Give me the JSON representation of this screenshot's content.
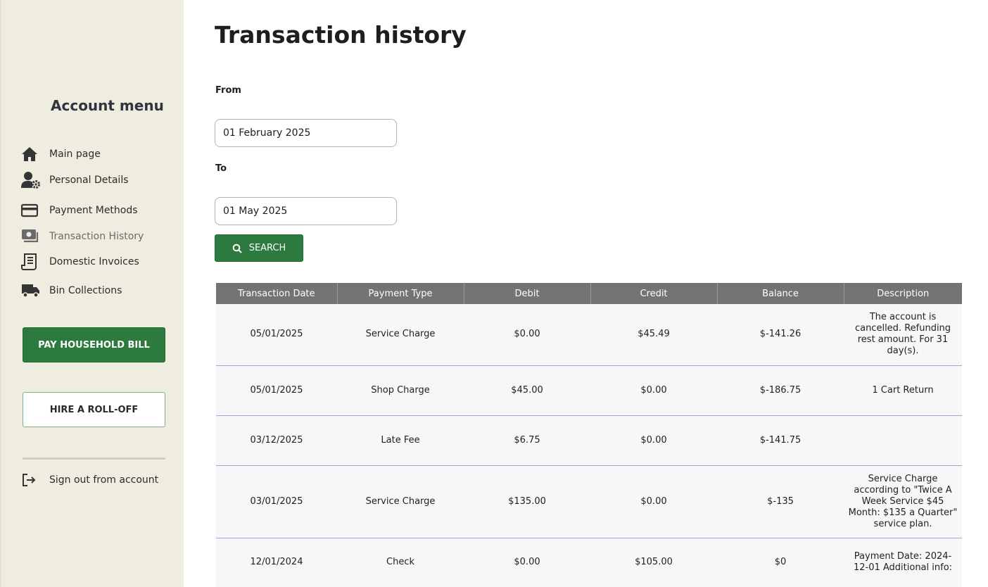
{
  "sidebar": {
    "title": "Account menu",
    "items": [
      {
        "label": "Main page",
        "icon": "home-icon"
      },
      {
        "label": "Personal Details",
        "icon": "user-gear-icon"
      },
      {
        "label": "Payment Methods",
        "icon": "credit-card-icon"
      },
      {
        "label": "Transaction History",
        "icon": "money-bill-icon",
        "active": true
      },
      {
        "label": "Domestic Invoices",
        "icon": "receipt-icon"
      },
      {
        "label": "Bin Collections",
        "icon": "truck-icon"
      }
    ],
    "pay_button": "PAY HOUSEHOLD BILL",
    "hire_button": "HIRE A ROLL-OFF",
    "signout": {
      "label": "Sign out from account",
      "icon": "sign-out-icon"
    }
  },
  "main": {
    "title": "Transaction history",
    "from_label": "From",
    "from_value": "01 February 2025",
    "to_label": "To",
    "to_value": "01 May 2025",
    "search_button": "SEARCH"
  },
  "table": {
    "headers": [
      "Transaction Date",
      "Payment Type",
      "Debit",
      "Credit",
      "Balance",
      "Description"
    ],
    "rows": [
      [
        "05/01/2025",
        "Service Charge",
        "$0.00",
        "$45.49",
        "$-141.26",
        "The account is cancelled. Refunding rest amount. For 31 day(s)."
      ],
      [
        "05/01/2025",
        "Shop Charge",
        "$45.00",
        "$0.00",
        "$-186.75",
        "1 Cart Return"
      ],
      [
        "03/12/2025",
        "Late Fee",
        "$6.75",
        "$0.00",
        "$-141.75",
        ""
      ],
      [
        "03/01/2025",
        "Service Charge",
        "$135.00",
        "$0.00",
        "$-135",
        "Service Charge according to \"Twice A Week Service $45 Month: $135 a Quarter\" service plan."
      ],
      [
        "12/01/2024",
        "Check",
        "$0.00",
        "$105.00",
        "$0",
        "Payment Date: 2024-12-01 Additional info:"
      ]
    ]
  },
  "colors": {
    "sidebar_bg": "#efede0",
    "accent_green": "#2c7a3d",
    "table_header_bg": "#737373",
    "row_divider": "#9fa8d8"
  }
}
